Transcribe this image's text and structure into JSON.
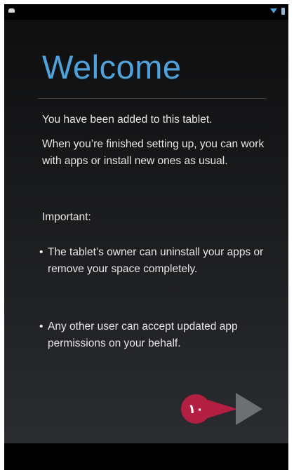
{
  "welcome": {
    "title": "Welcome",
    "added_text": "You have been added to this tablet.",
    "finished_text": "When you’re finished setting up, you can work with apps or install new ones as usual.",
    "important_label": "Important:",
    "bullets": [
      "The tablet’s owner can uninstall your apps or remove your space completely.",
      "Any other user can accept updated app permissions on your behalf."
    ],
    "bullet_mark": "•"
  },
  "callout": {
    "label": "۱۰",
    "color": "#b31f42"
  },
  "colors": {
    "title": "#4fa3dc",
    "next_arrow": "#6d6f72"
  },
  "icons": {
    "next": "next-arrow-icon",
    "status_left": "notification-icon",
    "wifi": "wifi-icon",
    "battery": "battery-icon"
  }
}
